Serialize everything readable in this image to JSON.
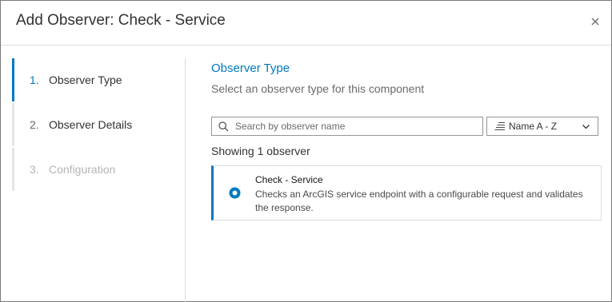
{
  "dialog": {
    "title": "Add Observer: Check - Service",
    "close_icon": "close-icon"
  },
  "stepper": {
    "steps": [
      {
        "number": "1.",
        "label": "Observer Type",
        "state": "active"
      },
      {
        "number": "2.",
        "label": "Observer Details",
        "state": "enabled"
      },
      {
        "number": "3.",
        "label": "Configuration",
        "state": "disabled"
      }
    ]
  },
  "main": {
    "title": "Observer Type",
    "subtitle": "Select an observer type for this component",
    "search": {
      "value": "",
      "placeholder": "Search by observer name",
      "icon": "search-icon"
    },
    "sort": {
      "selected": "Name A - Z",
      "icon": "sort-lines-icon",
      "chevron": "chevron-down-icon"
    },
    "count_text": "Showing 1 observer",
    "observers": [
      {
        "title": "Check - Service",
        "description": "Checks an ArcGIS service endpoint with a configurable request and validates the response.",
        "selected": true
      }
    ]
  },
  "colors": {
    "accent": "#0079c1",
    "text": "#323232",
    "muted": "#6a6a6a",
    "disabled": "#b5b5b5",
    "border": "#dcdcdc"
  }
}
